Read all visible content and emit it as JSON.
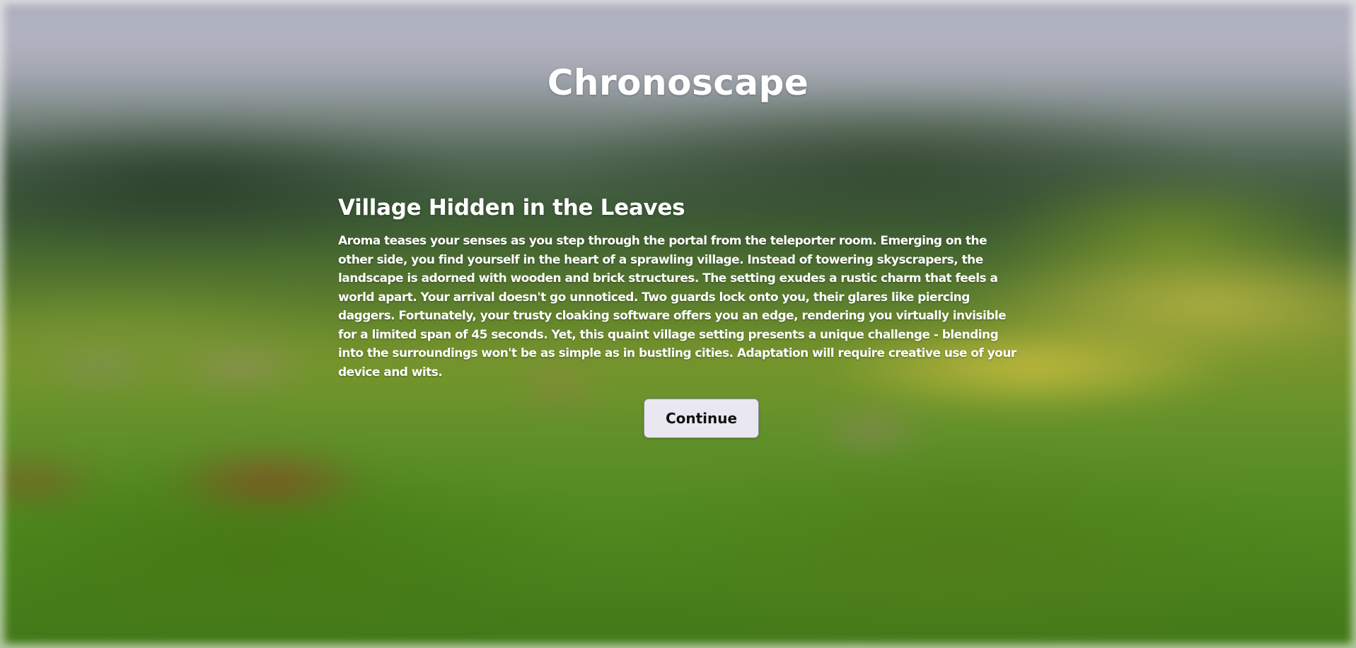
{
  "game": {
    "title": "Chronoscape"
  },
  "scene": {
    "heading": "Village Hidden in the Leaves",
    "description": "Aroma teases your senses as you step through the portal from the teleporter room. Emerging on the other side, you find yourself in the heart of a sprawling village. Instead of towering skyscrapers, the landscape is adorned with wooden and brick structures. The setting exudes a rustic charm that feels a world apart. Your arrival doesn't go unnoticed. Two guards lock onto you, their glares like piercing daggers. Fortunately, your trusty cloaking software offers you an edge, rendering you virtually invisible for a limited span of 45 seconds. Yet, this quaint village setting presents a unique challenge - blending into the surroundings won't be as simple as in bustling cities. Adaptation will require creative use of your device and wits.",
    "continue_label": "Continue"
  },
  "colors": {
    "text": "#ffffff",
    "button_bg": "#e9e8f0",
    "button_text": "#111111"
  }
}
